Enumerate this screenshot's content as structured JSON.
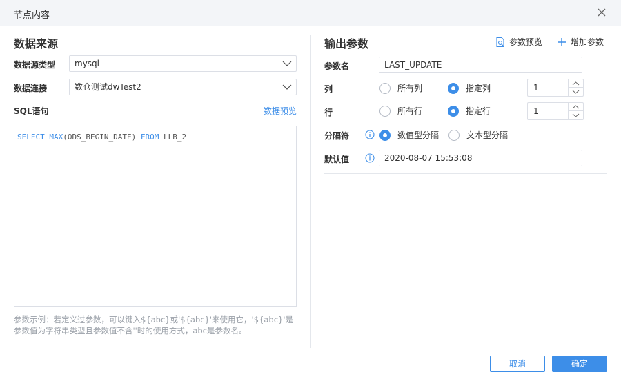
{
  "dialog": {
    "title": "节点内容",
    "close_icon": "close-icon"
  },
  "left": {
    "section_title": "数据来源",
    "source_type_label": "数据源类型",
    "source_type_value": "mysql",
    "connection_label": "数据连接",
    "connection_value": "数仓测试dwTest2",
    "sql_label": "SQL语句",
    "preview_link": "数据预览",
    "sql": {
      "kw1": "SELECT",
      "fn": "MAX",
      "arg": "(ODS_BEGIN_DATE)",
      "kw2": "FROM",
      "table": "LLB_2"
    },
    "hint": "参数示例：若定义过参数，可以键入${abc}或'${abc}'来使用它，'${abc}'是参数值为字符串类型且参数值不含''时的使用方式，abc是参数名。"
  },
  "right": {
    "section_title": "输出参数",
    "param_preview_label": "参数预览",
    "param_preview_icon": "document-preview-icon",
    "add_param_label": "增加参数",
    "add_param_icon": "plus-icon",
    "param_name_label": "参数名",
    "param_name_value": "LAST_UPDATE",
    "col_label": "列",
    "col_all_label": "所有列",
    "col_specify_label": "指定列",
    "col_selected": "指定列",
    "col_value": "1",
    "row_label": "行",
    "row_all_label": "所有行",
    "row_specify_label": "指定行",
    "row_selected": "指定行",
    "row_value": "1",
    "separator_label": "分隔符",
    "separator_numeric_label": "数值型分隔",
    "separator_text_label": "文本型分隔",
    "separator_selected": "数值型分隔",
    "default_label": "默认值",
    "default_value": "2020-08-07 15:53:08",
    "info_icon": "info-icon"
  },
  "footer": {
    "cancel_label": "取消",
    "ok_label": "确定"
  },
  "colors": {
    "accent": "#3d8ee8",
    "header_bg": "#f3f5f8",
    "border": "#dcdfe6",
    "hint_text": "#9aa0a8"
  }
}
